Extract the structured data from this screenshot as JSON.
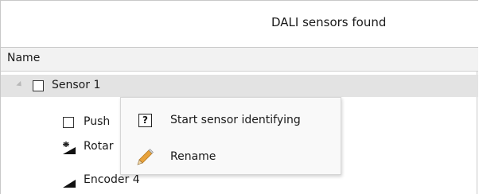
{
  "window": {
    "title": "DALI sensors found"
  },
  "table": {
    "column_name": "Name"
  },
  "tree": {
    "root": {
      "label": "Sensor 1",
      "expanded": true
    },
    "children": [
      {
        "label": "Push",
        "icon": "checkbox-icon"
      },
      {
        "label": "Rotar",
        "icon": "rotary-icon"
      },
      {
        "label": "Encoder 4",
        "icon": "encoder-icon"
      }
    ]
  },
  "context_menu": {
    "items": [
      {
        "label": "Start sensor identifying",
        "icon": "identify-icon"
      },
      {
        "label": "Rename",
        "icon": "pencil-icon"
      }
    ]
  },
  "colors": {
    "selected_row": "#e3e3e3",
    "header_bg": "#f2f2f2",
    "menu_bg": "#f9f9f9",
    "pencil_body": "#e8a33d"
  }
}
